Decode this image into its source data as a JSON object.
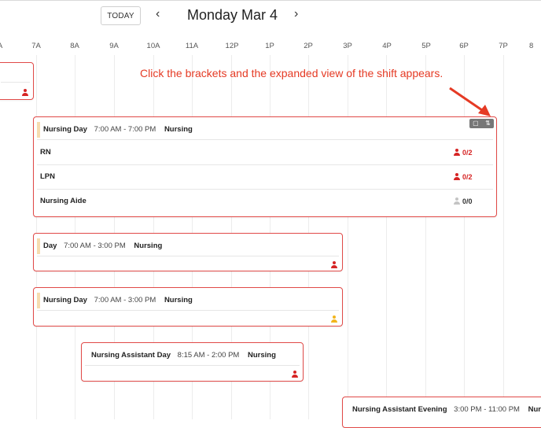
{
  "toolbar": {
    "today_label": "TODAY",
    "prev_label": "‹",
    "next_label": "›",
    "date_title": "Monday Mar 4"
  },
  "hours": [
    "A",
    "7A",
    "8A",
    "9A",
    "10A",
    "11A",
    "12P",
    "1P",
    "2P",
    "3P",
    "4P",
    "5P",
    "6P",
    "7P",
    "8"
  ],
  "annotation_text": "Click the brackets and the expanded view of the shift appears.",
  "expanded_shift": {
    "name": "Nursing Day",
    "time": "7:00 AM - 7:00 PM",
    "department": "Nursing",
    "roles": [
      {
        "label": "RN",
        "count": "0/2"
      },
      {
        "label": "LPN",
        "count": "0/2"
      },
      {
        "label": "Nursing Aide",
        "count": "0/0"
      }
    ]
  },
  "shifts": [
    {
      "name": "Day",
      "time": "7:00 AM - 3:00 PM",
      "department": "Nursing"
    },
    {
      "name": "Nursing Day",
      "time": "7:00 AM - 3:00 PM",
      "department": "Nursing"
    },
    {
      "name": "Nursing Assistant Day",
      "time": "8:15 AM - 2:00 PM",
      "department": "Nursing"
    },
    {
      "name": "Nursing Assistant Evening",
      "time": "3:00 PM - 11:00 PM",
      "department": "Nursi"
    }
  ],
  "colors": {
    "staff_red": "#d62424",
    "staff_yellow": "#f2b51d",
    "staff_grey": "#c4c4c4",
    "annotation_red": "#e53a24",
    "card_border": "#e14a48"
  }
}
